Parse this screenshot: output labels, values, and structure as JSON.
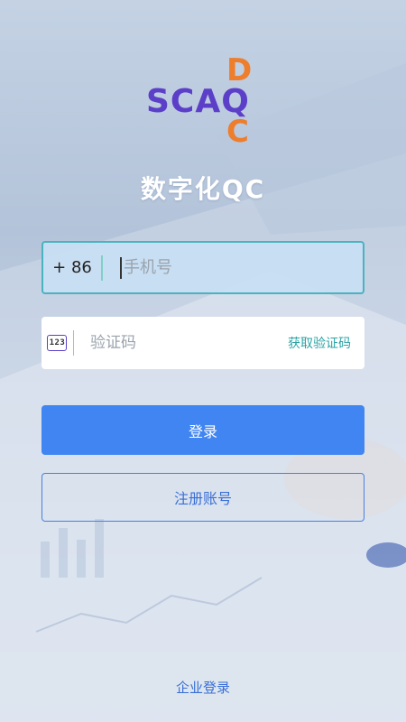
{
  "logo": {
    "main": "SCAQ",
    "top_letter": "D",
    "bottom_letter": "C"
  },
  "app_title": "数字化QC",
  "phone": {
    "country_code": "+ 86",
    "placeholder": "手机号",
    "value": ""
  },
  "code": {
    "icon_text": "123",
    "icon_name": "verification-code-icon",
    "placeholder": "验证码",
    "value": "",
    "get_code_label": "获取验证码"
  },
  "buttons": {
    "login": "登录",
    "register": "注册账号"
  },
  "footer": {
    "enterprise_login": "企业登录"
  },
  "colors": {
    "logo_main": "#5b3fc8",
    "logo_accent": "#ee7d2c",
    "primary": "#4085f2",
    "focus_border": "#49b3bf",
    "get_code": "#2aa3a4"
  }
}
